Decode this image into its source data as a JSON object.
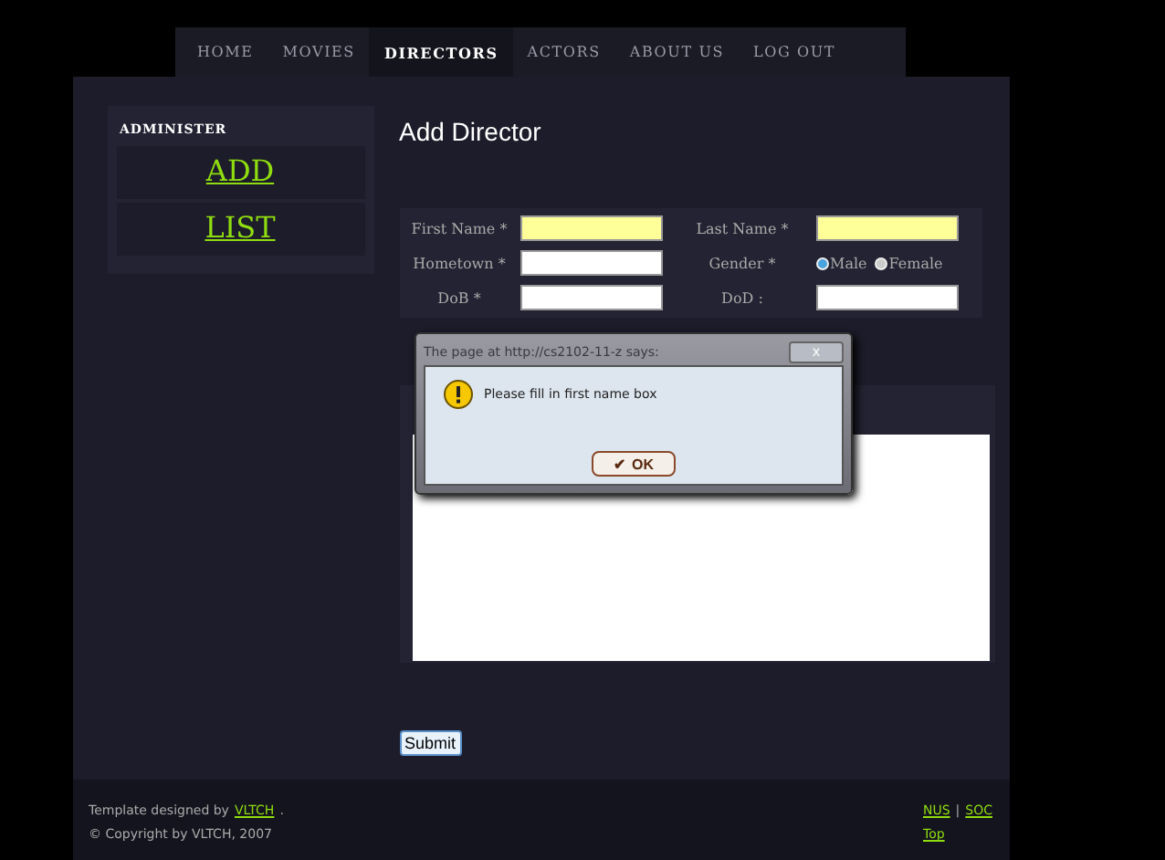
{
  "nav": [
    {
      "label": "HOME",
      "selected": false
    },
    {
      "label": "MOVIES",
      "selected": false
    },
    {
      "label": "DIRECTORS",
      "selected": true
    },
    {
      "label": "ACTORS",
      "selected": false
    },
    {
      "label": "ABOUT US",
      "selected": false
    },
    {
      "label": "LOG OUT",
      "selected": false
    }
  ],
  "sidebar": {
    "title": "ADMINISTER",
    "links": [
      "ADD",
      "LIST"
    ]
  },
  "heading": "Add Director",
  "form": {
    "rows": [
      [
        {
          "label": "First Name *",
          "kind": "text",
          "highlighted": true
        },
        {
          "label": "Last Name *",
          "kind": "text",
          "highlighted": true
        }
      ],
      [
        {
          "label": "Hometown *",
          "kind": "text",
          "highlighted": false
        },
        {
          "label": "Gender *",
          "kind": "radio",
          "options": [
            {
              "label": "Male",
              "selected": true
            },
            {
              "label": "Female",
              "selected": false
            }
          ]
        }
      ],
      [
        {
          "label": "DoB *",
          "kind": "text",
          "highlighted": false
        },
        {
          "label": "DoD :",
          "kind": "text",
          "highlighted": false
        }
      ]
    ],
    "submit": "Submit"
  },
  "footer": {
    "credit_prefix": "Template designed by",
    "credit_link": "VLTCH",
    "credit_suffix": ".",
    "copyright": "© Copyright by VLTCH, 2007",
    "links": [
      "NUS",
      "SOC"
    ],
    "separator": "|",
    "top": "Top"
  },
  "dialog": {
    "title": "The page at http://cs2102-11-z says:",
    "close": "x",
    "message": "Please fill in first name box",
    "ok_mark": "✔",
    "ok": "OK"
  }
}
